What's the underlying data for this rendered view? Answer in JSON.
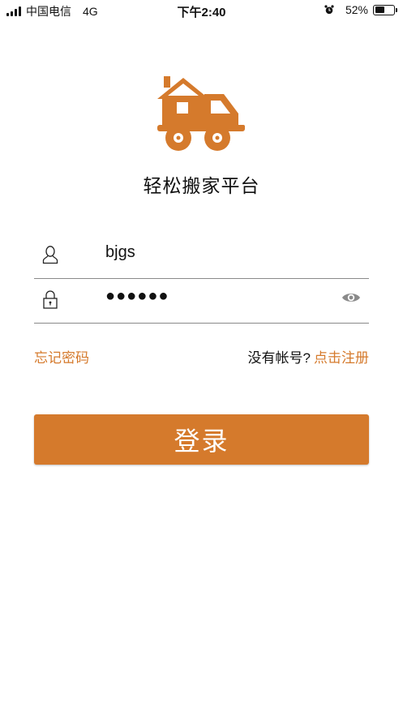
{
  "status_bar": {
    "carrier": "中国电信",
    "network": "4G",
    "time": "下午2:40",
    "battery_percent": "52%",
    "battery_level": 0.52
  },
  "app": {
    "title": "轻松搬家平台",
    "accent_color": "#d57a2c"
  },
  "login_form": {
    "username_value": "bjgs",
    "password_masked": "●●●●●●",
    "forgot_password": "忘记密码",
    "no_account": "没有帐号?",
    "register": "点击注册",
    "login_button": "登录"
  },
  "icons": {
    "logo": "house-truck-icon",
    "username": "user-icon",
    "password": "lock-icon",
    "show_password": "eye-icon",
    "alarm": "alarm-icon"
  }
}
